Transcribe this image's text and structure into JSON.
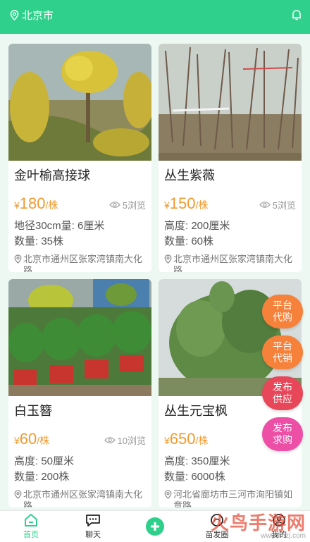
{
  "header": {
    "city": "北京市"
  },
  "listings": [
    {
      "title": "金叶榆高接球",
      "price_symbol": "¥",
      "price": "180",
      "unit": "/株",
      "views": "5浏览",
      "spec1": "地径30cm量: 6厘米",
      "spec2": "数量: 35株",
      "address": "北京市通州区张家湾镇南大化路",
      "photo": "yellow-leaf-elm-tree"
    },
    {
      "title": "丛生紫薇",
      "price_symbol": "¥",
      "price": "150",
      "unit": "/株",
      "views": "5浏览",
      "spec1": "高度: 200厘米",
      "spec2": "数量: 60株",
      "address": "北京市通州区张家湾镇南大化路",
      "photo": "crape-myrtle-shrubs"
    },
    {
      "title": "白玉簪",
      "price_symbol": "¥",
      "price": "60",
      "unit": "/株",
      "views": "10浏览",
      "spec1": "高度: 50厘米",
      "spec2": "数量: 200株",
      "address": "北京市通州区张家湾镇南大化路",
      "photo": "potted-hosta-plants"
    },
    {
      "title": "丛生元宝枫",
      "price_symbol": "¥",
      "price": "650",
      "unit": "/株",
      "views": "",
      "spec1": "高度: 350厘米",
      "spec2": "数量: 6000株",
      "address": "河北省廊坊市三河市洵阳镇如意路",
      "photo": "maple-tree-cluster"
    }
  ],
  "float_buttons": [
    {
      "label": "平台代购",
      "color": "#f5813b"
    },
    {
      "label": "平台代销",
      "color": "#f5813b"
    },
    {
      "label": "发布供应",
      "color": "#e8475a"
    },
    {
      "label": "发布求购",
      "color": "#ee4fa6"
    }
  ],
  "nav": {
    "home": "首页",
    "chat": "聊天",
    "publish": "苗发圈",
    "me": "我的"
  },
  "watermark": {
    "text": "火鸟手游网",
    "url": "www.hnzj.com"
  },
  "colors": {
    "brand": "#2fd08b",
    "price": "#f29a2e"
  }
}
